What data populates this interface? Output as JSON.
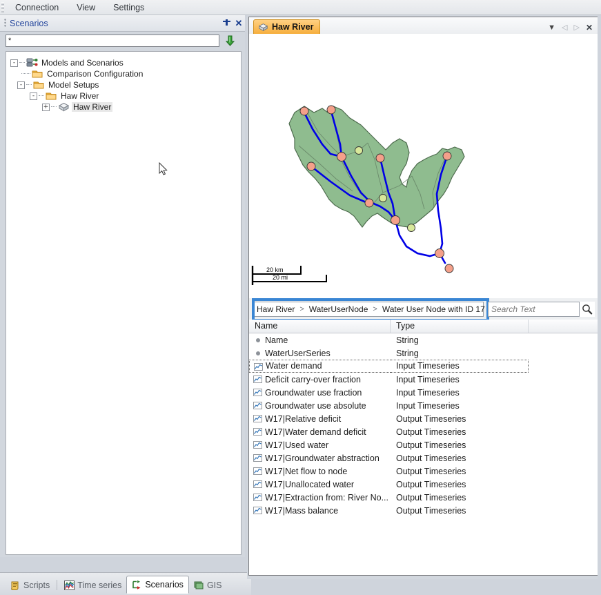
{
  "menu": {
    "items": [
      {
        "label": "Connection"
      },
      {
        "label": "View"
      },
      {
        "label": "Settings"
      }
    ]
  },
  "sidebar": {
    "caption": "Scenarios",
    "pin_icon": "pin-icon",
    "close_icon": "close-icon",
    "filter": {
      "value": "*",
      "placeholder": ""
    },
    "refresh_icon": "down-arrow-icon",
    "tree": [
      {
        "label": "Models and Scenarios",
        "icon": "models-scenarios-icon",
        "expander": "-",
        "depth": 0,
        "selected": false
      },
      {
        "label": "Comparison Configuration",
        "icon": "folder-icon",
        "expander": "",
        "depth": 1,
        "selected": false
      },
      {
        "label": "Model Setups",
        "icon": "folder-icon",
        "expander": "-",
        "depth": 1,
        "selected": false
      },
      {
        "label": "Haw River",
        "icon": "folder-icon",
        "expander": "-",
        "depth": 2,
        "selected": false
      },
      {
        "label": "Haw River",
        "icon": "cube-icon",
        "expander": "+",
        "depth": 3,
        "selected": true
      }
    ]
  },
  "bottom_tabs": [
    {
      "label": "Scripts",
      "icon": "scripts-icon",
      "active": false
    },
    {
      "label": "Time series",
      "icon": "timeseries-icon",
      "active": false
    },
    {
      "label": "Scenarios",
      "icon": "scenarios-icon",
      "active": true
    },
    {
      "label": "GIS",
      "icon": "gis-icon",
      "active": false
    }
  ],
  "document": {
    "tab": {
      "label": "Haw River",
      "icon": "cube-icon"
    },
    "nav": {
      "dropdown_icon": "chevron-down-icon",
      "prev_icon": "triangle-left-icon",
      "next_icon": "triangle-right-icon",
      "close_icon": "close-icon"
    },
    "map": {
      "scale_km": "20 km",
      "scale_mi": "20 mi",
      "basin_fill": "#8fbc8f",
      "basin_stroke": "#4d6b4d",
      "river_color": "#0000e6",
      "node_color": "#f4a08a",
      "node_alt_color": "#d8e89a"
    }
  },
  "breadcrumb": {
    "items": [
      "Haw River",
      "WaterUserNode",
      "Water User Node with ID 17"
    ],
    "separator": ">",
    "trailing_separator": ">",
    "highlight_color": "#3a86d4"
  },
  "search": {
    "placeholder": "Search Text",
    "value": "",
    "icon": "magnifier-icon"
  },
  "grid": {
    "columns": [
      "Name",
      "Type",
      ""
    ],
    "rows": [
      {
        "name": "Name",
        "type": "String",
        "icon": "bullet-icon",
        "focused": false
      },
      {
        "name": "WaterUserSeries",
        "type": "String",
        "icon": "bullet-icon",
        "focused": false
      },
      {
        "name": "Water demand",
        "type": "Input Timeseries",
        "icon": "timeseries-icon",
        "focused": true
      },
      {
        "name": "Deficit carry-over fraction",
        "type": "Input Timeseries",
        "icon": "timeseries-icon",
        "focused": false
      },
      {
        "name": "Groundwater use fraction",
        "type": "Input Timeseries",
        "icon": "timeseries-icon",
        "focused": false
      },
      {
        "name": "Groundwater use absolute",
        "type": "Input Timeseries",
        "icon": "timeseries-icon",
        "focused": false
      },
      {
        "name": "W17|Relative deficit",
        "type": "Output Timeseries",
        "icon": "timeseries-icon",
        "focused": false
      },
      {
        "name": "W17|Water demand deficit",
        "type": "Output Timeseries",
        "icon": "timeseries-icon",
        "focused": false
      },
      {
        "name": "W17|Used water",
        "type": "Output Timeseries",
        "icon": "timeseries-icon",
        "focused": false
      },
      {
        "name": "W17|Groundwater abstraction",
        "type": "Output Timeseries",
        "icon": "timeseries-icon",
        "focused": false
      },
      {
        "name": "W17|Net flow to node",
        "type": "Output Timeseries",
        "icon": "timeseries-icon",
        "focused": false
      },
      {
        "name": "W17|Unallocated water",
        "type": "Output Timeseries",
        "icon": "timeseries-icon",
        "focused": false
      },
      {
        "name": "W17|Extraction from:  River No...",
        "type": "Output Timeseries",
        "icon": "timeseries-icon",
        "focused": false
      },
      {
        "name": "W17|Mass balance",
        "type": "Output Timeseries",
        "icon": "timeseries-icon",
        "focused": false
      }
    ]
  }
}
